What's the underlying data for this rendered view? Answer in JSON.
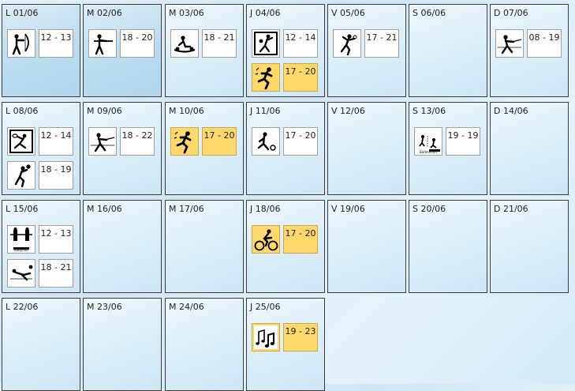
{
  "calendar": {
    "days": [
      {
        "label": "L 01/06",
        "events": [
          {
            "icon": "archery-icon",
            "time": "12 - 13",
            "highlight": false
          }
        ]
      },
      {
        "label": "M 02/06",
        "events": [
          {
            "icon": "shooting-icon",
            "time": "18 - 20",
            "highlight": false
          }
        ]
      },
      {
        "label": "M 03/06",
        "events": [
          {
            "icon": "rowing-icon",
            "time": "18 - 21",
            "highlight": false
          }
        ]
      },
      {
        "label": "J 04/06",
        "events": [
          {
            "icon": "handball-icon",
            "time": "12 - 14",
            "highlight": false
          },
          {
            "icon": "running-icon",
            "time": "17 - 20",
            "highlight": true
          }
        ]
      },
      {
        "label": "V 05/06",
        "events": [
          {
            "icon": "fencing-pose-icon",
            "time": "17 - 21",
            "highlight": false
          }
        ]
      },
      {
        "label": "S 06/06",
        "events": []
      },
      {
        "label": "D 07/06",
        "events": [
          {
            "icon": "fencing-icon",
            "time": "08 - 19",
            "highlight": false
          }
        ]
      },
      {
        "label": "L 08/06",
        "events": [
          {
            "icon": "tennis-icon",
            "time": "12 - 14",
            "highlight": false
          },
          {
            "icon": "basketball-icon",
            "time": "18 - 19",
            "highlight": false
          }
        ]
      },
      {
        "label": "M 09/06",
        "events": [
          {
            "icon": "fencing-icon",
            "time": "18 - 22",
            "highlight": false
          }
        ]
      },
      {
        "label": "M 10/06",
        "events": [
          {
            "icon": "running-icon",
            "time": "17 - 20",
            "highlight": true
          }
        ]
      },
      {
        "label": "J 11/06",
        "events": [
          {
            "icon": "bowling-icon",
            "time": "17 - 20",
            "highlight": false
          }
        ]
      },
      {
        "label": "V 12/06",
        "events": []
      },
      {
        "label": "S 13/06",
        "events": [
          {
            "icon": "badminton-icon",
            "time": "19 - 19",
            "highlight": false
          }
        ]
      },
      {
        "label": "D 14/06",
        "events": []
      },
      {
        "label": "L 15/06",
        "events": [
          {
            "icon": "babyfoot-icon",
            "time": "12 - 13",
            "highlight": false
          },
          {
            "icon": "volleyball-dive-icon",
            "time": "18 - 21",
            "highlight": false
          }
        ]
      },
      {
        "label": "M 16/06",
        "events": []
      },
      {
        "label": "M 17/06",
        "events": []
      },
      {
        "label": "J 18/06",
        "events": [
          {
            "icon": "cycling-icon",
            "time": "17 - 20",
            "highlight": true
          }
        ]
      },
      {
        "label": "V 19/06",
        "events": []
      },
      {
        "label": "S 20/06",
        "events": []
      },
      {
        "label": "D 21/06",
        "events": []
      },
      {
        "label": "L 22/06",
        "events": []
      },
      {
        "label": "M 23/06",
        "events": []
      },
      {
        "label": "M 24/06",
        "events": []
      },
      {
        "label": "J 25/06",
        "events": [
          {
            "icon": "music-icon",
            "time": "19 - 23",
            "highlight": true
          }
        ]
      }
    ],
    "icon_text": {
      "badminton_caption": "Badminton",
      "babyfoot_caption": "Babyfoot"
    },
    "colors": {
      "highlight": "#ffd86c",
      "border": "#3c3c3c"
    }
  }
}
